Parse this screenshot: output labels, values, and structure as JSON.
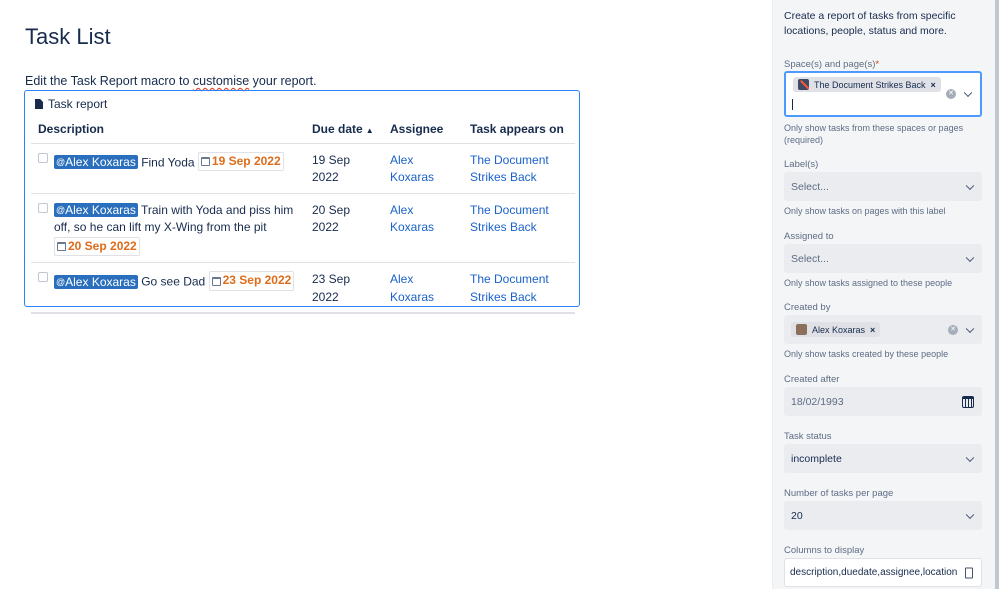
{
  "page": {
    "title": "Task List",
    "intro_before": "Edit the Task Report macro to ",
    "intro_misspelled": "customise",
    "intro_after": " your report."
  },
  "macro": {
    "title": "Task report",
    "columns": {
      "description": "Description",
      "due_date": "Due date",
      "assignee": "Assignee",
      "location": "Task appears on"
    },
    "sort_indicator": "▲",
    "rows": [
      {
        "mention": "Alex Koxaras",
        "text": "Find Yoda",
        "date_lozenge": "19 Sep 2022",
        "due_date": "19 Sep 2022",
        "assignee": "Alex Koxaras",
        "location_line1": "The Document",
        "location_line2": "Strikes Back"
      },
      {
        "mention": "Alex Koxaras",
        "text": "Train with Yoda and piss him off, so he can lift my X-Wing from the pit",
        "date_lozenge": "20 Sep 2022",
        "due_date": "20 Sep 2022",
        "assignee": "Alex Koxaras",
        "location_line1": "The Document",
        "location_line2": "Strikes Back"
      },
      {
        "mention": "Alex Koxaras",
        "text": "Go see Dad",
        "date_lozenge": "23 Sep 2022",
        "due_date": "23 Sep 2022",
        "assignee": "Alex Koxaras",
        "location_line1": "The Document",
        "location_line2": "Strikes Back"
      }
    ]
  },
  "panel": {
    "description": "Create a report of tasks from specific locations, people, status and more.",
    "spaces": {
      "label": "Space(s) and page(s)",
      "required_mark": "*",
      "chip": "The Document Strikes Back",
      "help": "Only show tasks from these spaces or pages (required)"
    },
    "labels": {
      "label": "Label(s)",
      "placeholder": "Select...",
      "help": "Only show tasks on pages with this label"
    },
    "assigned_to": {
      "label": "Assigned to",
      "placeholder": "Select...",
      "help": "Only show tasks assigned to these people"
    },
    "created_by": {
      "label": "Created by",
      "chip": "Alex Koxaras",
      "help": "Only show tasks created by these people"
    },
    "created_after": {
      "label": "Created after",
      "value": "18/02/1993"
    },
    "task_status": {
      "label": "Task status",
      "value": "incomplete"
    },
    "tasks_per_page": {
      "label": "Number of tasks per page",
      "value": "20"
    },
    "columns": {
      "label": "Columns to display",
      "value": "description,duedate,assignee,location"
    }
  },
  "colors": {
    "mention_bg": "#2a6fbd",
    "date_text": "#de6c1a",
    "link": "#1a62c9",
    "focus_border": "#4c9aff"
  }
}
